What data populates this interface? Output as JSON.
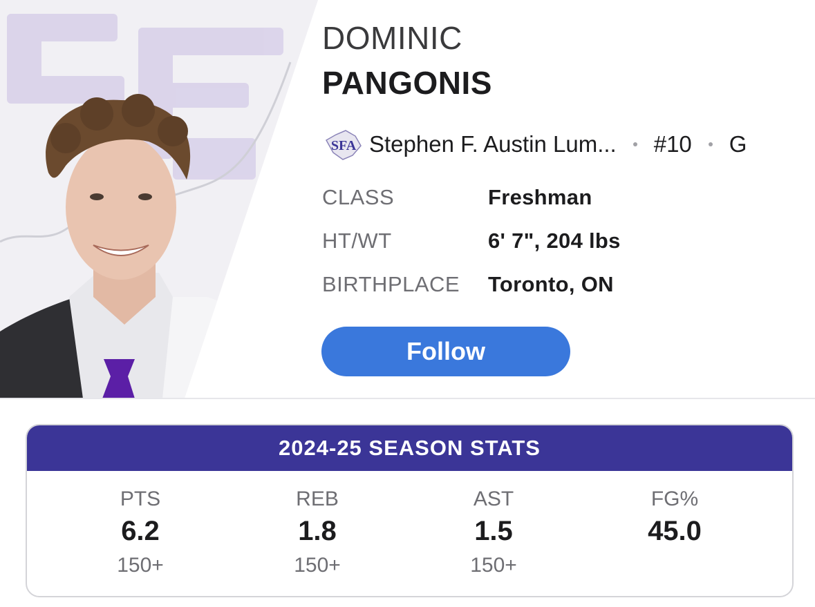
{
  "player": {
    "first_name": "DOMINIC",
    "last_name": "PANGONIS",
    "team": "Stephen F. Austin Lum...",
    "team_logo_text": "SFA",
    "number": "#10",
    "position": "G"
  },
  "info": [
    {
      "label": "CLASS",
      "value": "Freshman"
    },
    {
      "label": "HT/WT",
      "value": "6' 7\", 204 lbs"
    },
    {
      "label": "BIRTHPLACE",
      "value": "Toronto, ON"
    }
  ],
  "follow_label": "Follow",
  "stats": {
    "title": "2024-25 SEASON STATS",
    "items": [
      {
        "label": "PTS",
        "value": "6.2",
        "rank": "150+"
      },
      {
        "label": "REB",
        "value": "1.8",
        "rank": "150+"
      },
      {
        "label": "AST",
        "value": "1.5",
        "rank": "150+"
      },
      {
        "label": "FG%",
        "value": "45.0",
        "rank": ""
      }
    ]
  },
  "colors": {
    "accent_blue": "#3a78dc",
    "team_purple": "#3b3597",
    "tie_purple": "#5b1fa6"
  }
}
